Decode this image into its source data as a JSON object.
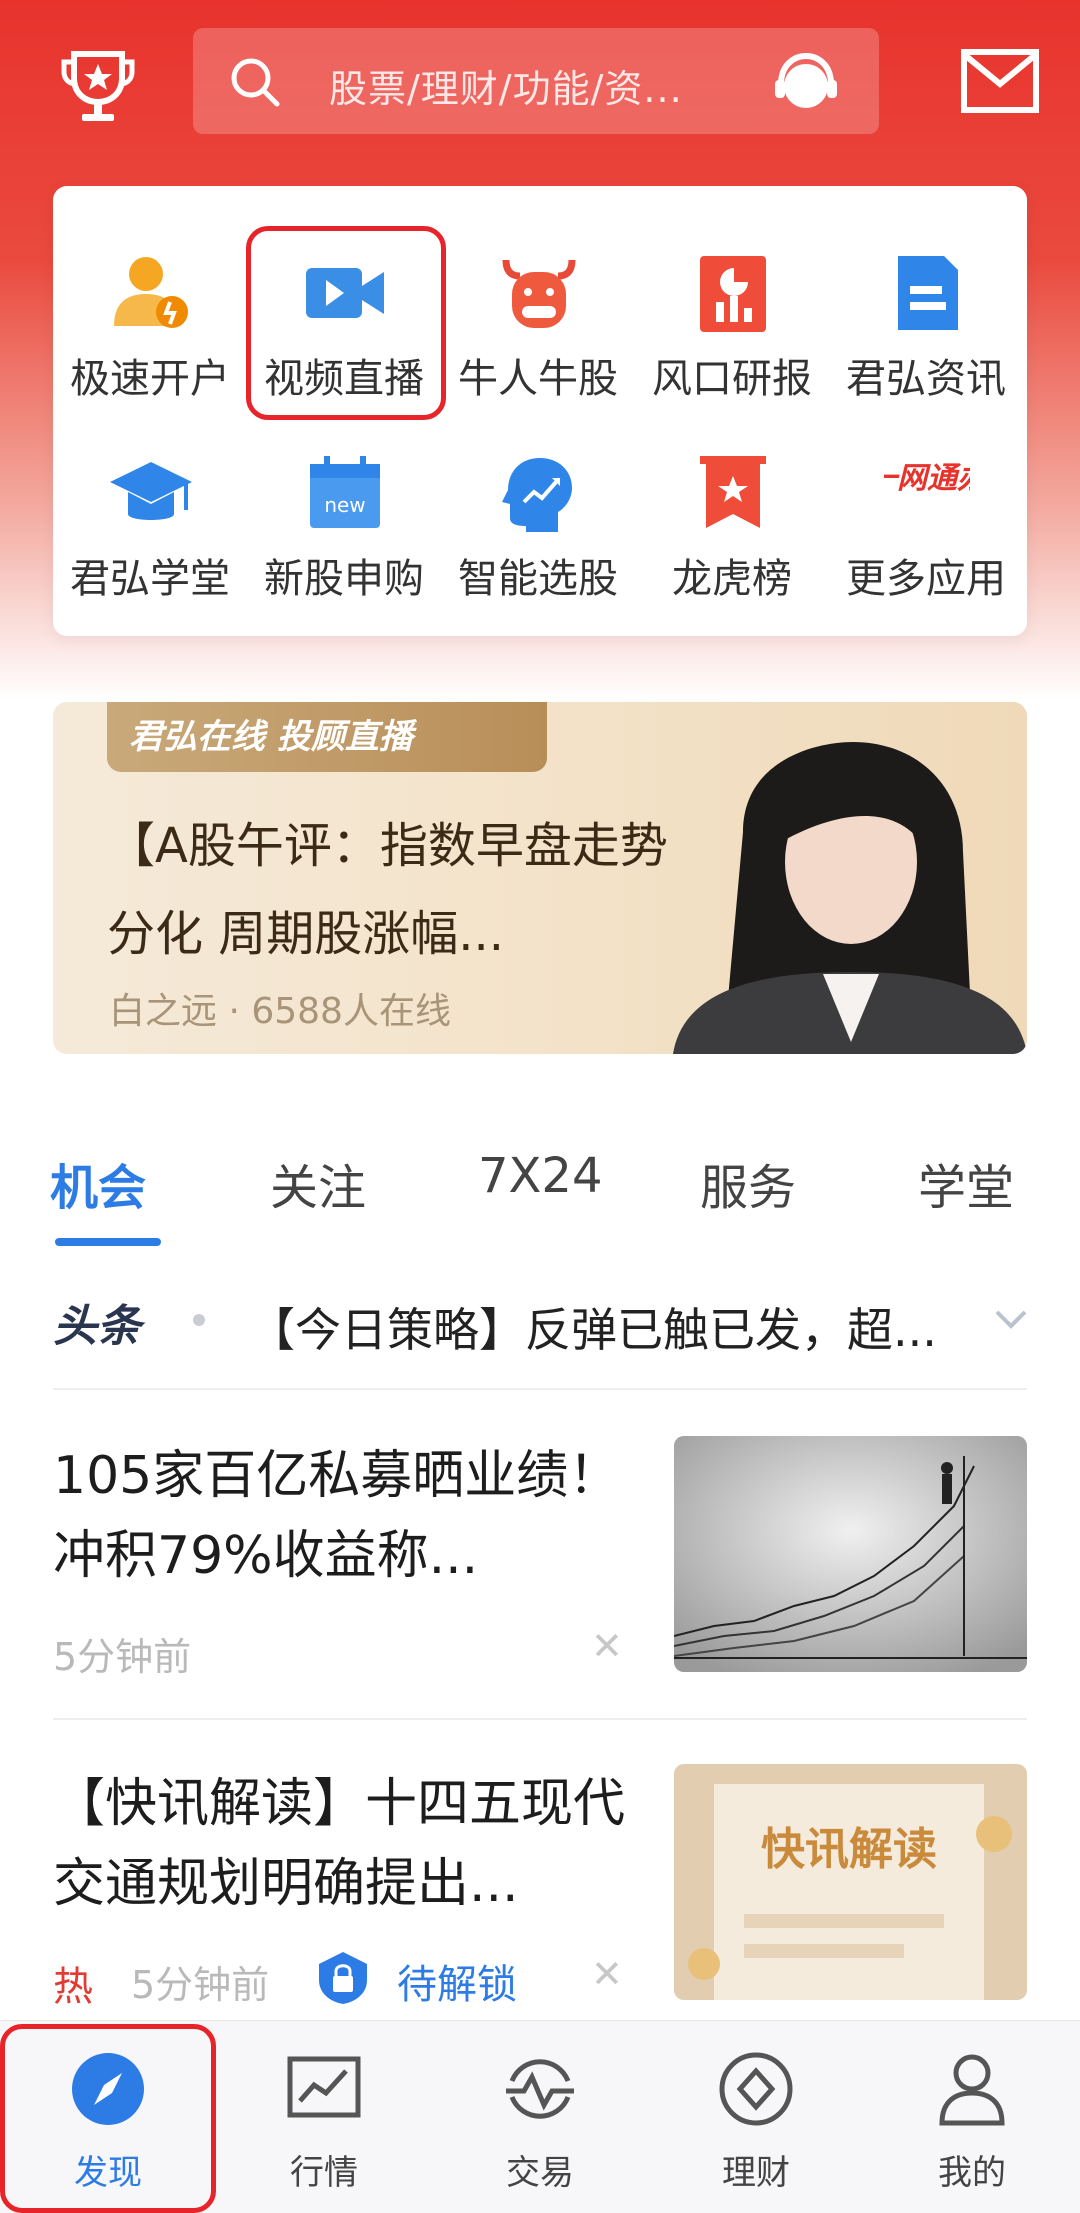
{
  "header": {
    "search_placeholder": "股票/理财/功能/资...",
    "icons": [
      "trophy-icon",
      "search-icon",
      "customer-service-icon",
      "mail-icon"
    ]
  },
  "quick_grid": {
    "items": [
      {
        "label": "极速开户",
        "icon": "open-account-icon"
      },
      {
        "label": "视频直播",
        "icon": "video-live-icon"
      },
      {
        "label": "牛人牛股",
        "icon": "bull-icon"
      },
      {
        "label": "风口研报",
        "icon": "report-icon"
      },
      {
        "label": "君弘资讯",
        "icon": "news-doc-icon"
      },
      {
        "label": "君弘学堂",
        "icon": "graduation-cap-icon"
      },
      {
        "label": "新股申购",
        "icon": "new-calendar-icon"
      },
      {
        "label": "智能选股",
        "icon": "smart-head-icon"
      },
      {
        "label": "龙虎榜",
        "icon": "ribbon-star-icon"
      },
      {
        "label": "更多应用",
        "icon": "one-stop-icon",
        "icon_text": "一网通办"
      }
    ]
  },
  "banner": {
    "tag": "君弘在线 投顾直播",
    "title": "【A股午评：指数早盘走势分化 周期股涨幅...",
    "meta": "白之远 · 6588人在线"
  },
  "tabs": [
    "机会",
    "关注",
    "7X24",
    "服务",
    "学堂"
  ],
  "headline": {
    "logo": "头条",
    "text": "【今日策略】反弹已触已发，超..."
  },
  "news": [
    {
      "title": "105家百亿私募晒业绩！冲积79%收益称...",
      "time": "5分钟前"
    },
    {
      "title": "【快讯解读】十四五现代交通规划明确提出...",
      "hot": "热",
      "time": "5分钟前",
      "lock_label": "待解锁",
      "image_text": "快讯解读"
    }
  ],
  "bottom_nav": [
    {
      "label": "发现",
      "icon": "compass-icon",
      "active": true
    },
    {
      "label": "行情",
      "icon": "market-chart-icon"
    },
    {
      "label": "交易",
      "icon": "trade-wave-icon"
    },
    {
      "label": "理财",
      "icon": "diamond-icon"
    },
    {
      "label": "我的",
      "icon": "user-icon"
    }
  ],
  "colors": {
    "brand_red": "#e8332d",
    "accent_blue": "#2d7be5",
    "highlight_red": "#e8242b"
  }
}
